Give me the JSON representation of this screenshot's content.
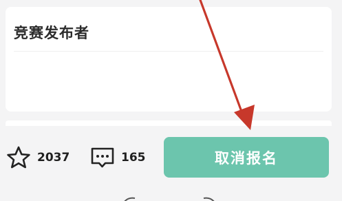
{
  "publisher_card": {
    "title": "竞赛发布者"
  },
  "action_bar": {
    "favorites": {
      "icon": "star-outline-icon",
      "count": "2037"
    },
    "comments": {
      "icon": "comment-bubble-icon",
      "count": "165"
    },
    "cancel_button": {
      "label": "取消报名"
    }
  },
  "colors": {
    "primary_button": "#6cc5ad",
    "annotation_arrow": "#c7382b",
    "background": "#f4f4f5",
    "card": "#ffffff"
  }
}
